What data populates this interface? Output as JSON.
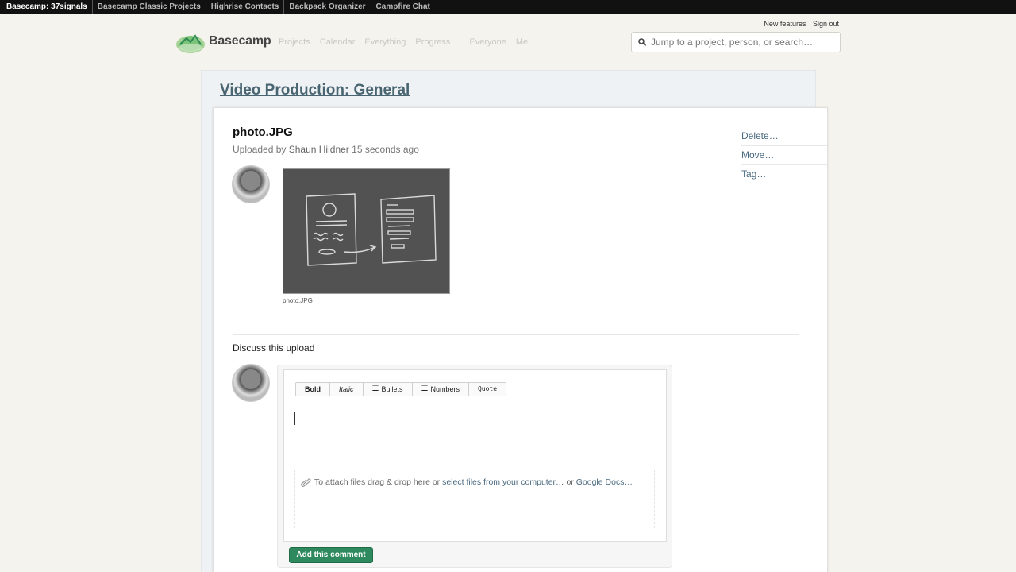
{
  "appbar": {
    "items": [
      "Basecamp: 37signals",
      "Basecamp Classic Projects",
      "Highrise Contacts",
      "Backpack Organizer",
      "Campfire Chat"
    ]
  },
  "utility": {
    "new_features": "New features",
    "sign_out": "Sign out"
  },
  "brand": {
    "name": "Basecamp"
  },
  "nav": {
    "projects": "Projects",
    "calendar": "Calendar",
    "everything": "Everything",
    "progress": "Progress",
    "everyone": "Everyone",
    "me": "Me"
  },
  "search": {
    "placeholder": "Jump to a project, person, or search…"
  },
  "project": {
    "title": "Video Production: General"
  },
  "file": {
    "name": "photo.JPG",
    "uploaded_prefix": "Uploaded by",
    "uploader": "Shaun Hildner",
    "when": "15 seconds ago",
    "caption": "photo.JPG"
  },
  "actions": {
    "delete": "Delete…",
    "move": "Move…",
    "tag": "Tag…"
  },
  "discussion": {
    "heading": "Discuss this upload"
  },
  "editor": {
    "bold": "Bold",
    "italic": "Italic",
    "bullets": "Bullets",
    "numbers": "Numbers",
    "quote": "Quote",
    "attach_prefix": "To attach files drag & drop here or",
    "attach_link1": "select files from your computer…",
    "attach_or": "or",
    "attach_link2": "Google Docs…"
  },
  "submit": {
    "label": "Add this comment"
  },
  "colors": {
    "accent_green": "#2e8a5e",
    "link_blue": "#4a6a80",
    "title_slate": "#4a6572"
  }
}
